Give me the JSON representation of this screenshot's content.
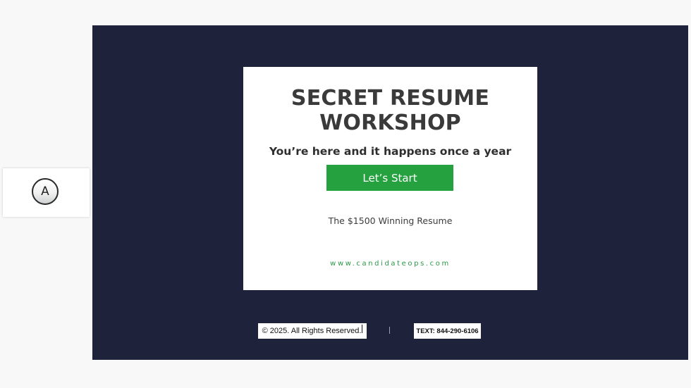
{
  "side_widget": {
    "button_label": "A"
  },
  "card": {
    "title_line1": "SECRET RESUME",
    "title_line2": "WORKSHOP",
    "subtitle": "You’re here and it happens once a year",
    "start_button_label": "Let’s Start",
    "resume_text": "The $1500 Winning Resume",
    "website": "www.candidateops.com"
  },
  "footer": {
    "copyright": "© 2025. All Rights Reserved.",
    "text_line": "TEXT: 844-290-6106"
  },
  "colors": {
    "stage_background": "#1e233b",
    "button_green": "#25a13f",
    "url_green": "#2a9a45"
  }
}
